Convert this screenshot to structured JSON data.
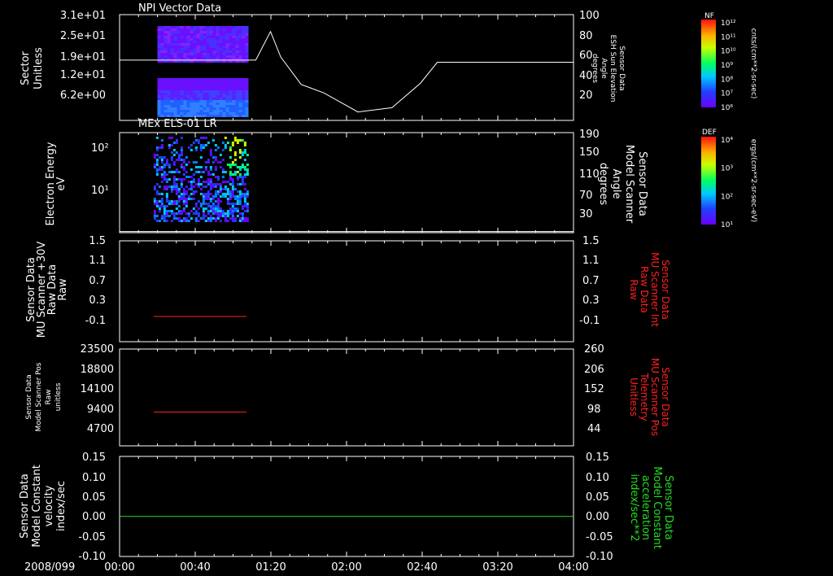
{
  "date_label": "2008/099",
  "time_ticks": [
    "00:00",
    "00:40",
    "01:20",
    "02:00",
    "02:40",
    "03:20",
    "04:00"
  ],
  "chart_data": [
    {
      "type": "heatmap",
      "title": "NPI Vector Data",
      "ylabel_lines": [
        "Sector",
        "Unitless"
      ],
      "yticks": [
        "3.1e+01",
        "2.5e+01",
        "1.9e+01",
        "1.2e+01",
        "6.2e+00"
      ],
      "right_ylabel_lines": [
        "Sensor Data",
        "ESH Sun Elevation",
        "Angle",
        "degrees"
      ],
      "right_yticks": [
        "100",
        "80",
        "60",
        "40",
        "20"
      ],
      "right_ylim": [
        0,
        100
      ],
      "x_range_hours": [
        0,
        4
      ],
      "heatmap_time_range": [
        "00:20",
        "01:07"
      ],
      "line_series": {
        "x_hours": [
          0,
          1.2,
          1.33,
          1.42,
          1.6,
          1.8,
          2.1,
          2.4,
          2.65,
          2.8,
          4.0
        ],
        "y_degrees": [
          57,
          57,
          84,
          60,
          34,
          26,
          8,
          12,
          35,
          55,
          55
        ]
      },
      "colorbar": {
        "label": "NF",
        "unit": "cnts/(cm**2-sr-sec)",
        "ticks": [
          "10¹²",
          "10¹¹",
          "10¹⁰",
          "10⁹",
          "10⁸",
          "10⁷",
          "10⁶"
        ]
      }
    },
    {
      "type": "heatmap",
      "title": "MEx ELS-01 LR",
      "ylabel_lines": [
        "Electron Energy",
        "eV"
      ],
      "yticks": [
        "10²",
        "10¹"
      ],
      "right_ylabel_lines": [
        "Sensor Data",
        "Model Scanner",
        "Angle",
        "degrees"
      ],
      "right_yticks": [
        "190",
        "150",
        "110",
        "70",
        "30"
      ],
      "right_ylim": [
        10,
        190
      ],
      "x_range_hours": [
        0,
        4
      ],
      "heatmap_time_range": [
        "00:18",
        "01:08"
      ],
      "line_series": {
        "x_hours": [
          0,
          4
        ],
        "y_degrees": [
          12,
          12
        ]
      },
      "colorbar": {
        "label": "DEF",
        "unit": "ergs/(cm**2-sr-sec-eV)",
        "ticks": [
          "10⁴",
          "10³",
          "10²",
          "10¹"
        ]
      }
    },
    {
      "type": "line",
      "ylabel_lines": [
        "Sensor Data",
        "MU Scanner +30V",
        "Raw Data",
        "Raw"
      ],
      "yticks": [
        "1.5",
        "1.1",
        "0.7",
        "0.3",
        "-0.1"
      ],
      "ylim": [
        -0.5,
        1.5
      ],
      "right_ylabel_lines": [
        "Sensor Data",
        "MU Scanner Int",
        "Raw Data",
        "Raw"
      ],
      "right_yticks": [
        "1.5",
        "1.1",
        "0.7",
        "0.3",
        "-0.1"
      ],
      "series": [
        {
          "color": "#ff2020",
          "x_hours": [
            0.3,
            1.12
          ],
          "y": [
            0.0,
            0.0
          ]
        }
      ]
    },
    {
      "type": "line",
      "ylabel_lines": [
        "Sensor Data",
        "Model Scanner Pos",
        "Raw",
        "unitless"
      ],
      "yticks": [
        "23500",
        "18800",
        "14100",
        "9400",
        "4700"
      ],
      "ylim": [
        0,
        23500
      ],
      "right_ylabel_lines": [
        "Sensor Data",
        "MU Scanner Pos",
        "Telemetry",
        "Unitless"
      ],
      "right_yticks": [
        "260",
        "206",
        "152",
        "98",
        "44"
      ],
      "series": [
        {
          "color": "#ff2020",
          "x_hours": [
            0.3,
            1.12
          ],
          "y": [
            8200,
            8200
          ]
        }
      ]
    },
    {
      "type": "line",
      "ylabel_lines": [
        "Sensor Data",
        "Model Constant",
        "velocity",
        "index/sec"
      ],
      "yticks": [
        "0.15",
        "0.10",
        "0.05",
        "0.00",
        "-0.05",
        "-0.10"
      ],
      "ylim": [
        -0.1,
        0.15
      ],
      "right_ylabel_lines": [
        "Sensor Data",
        "Model Constant",
        "acceleration",
        "index/sec**2"
      ],
      "right_yticks": [
        "0.15",
        "0.10",
        "0.05",
        "0.00",
        "-0.05",
        "-0.10"
      ],
      "series": [
        {
          "color": "#22dd22",
          "x_hours": [
            0,
            4
          ],
          "y": [
            0,
            0
          ]
        }
      ]
    }
  ],
  "colors": {
    "right_label_red": "#ff2020",
    "right_label_green": "#22dd22"
  }
}
